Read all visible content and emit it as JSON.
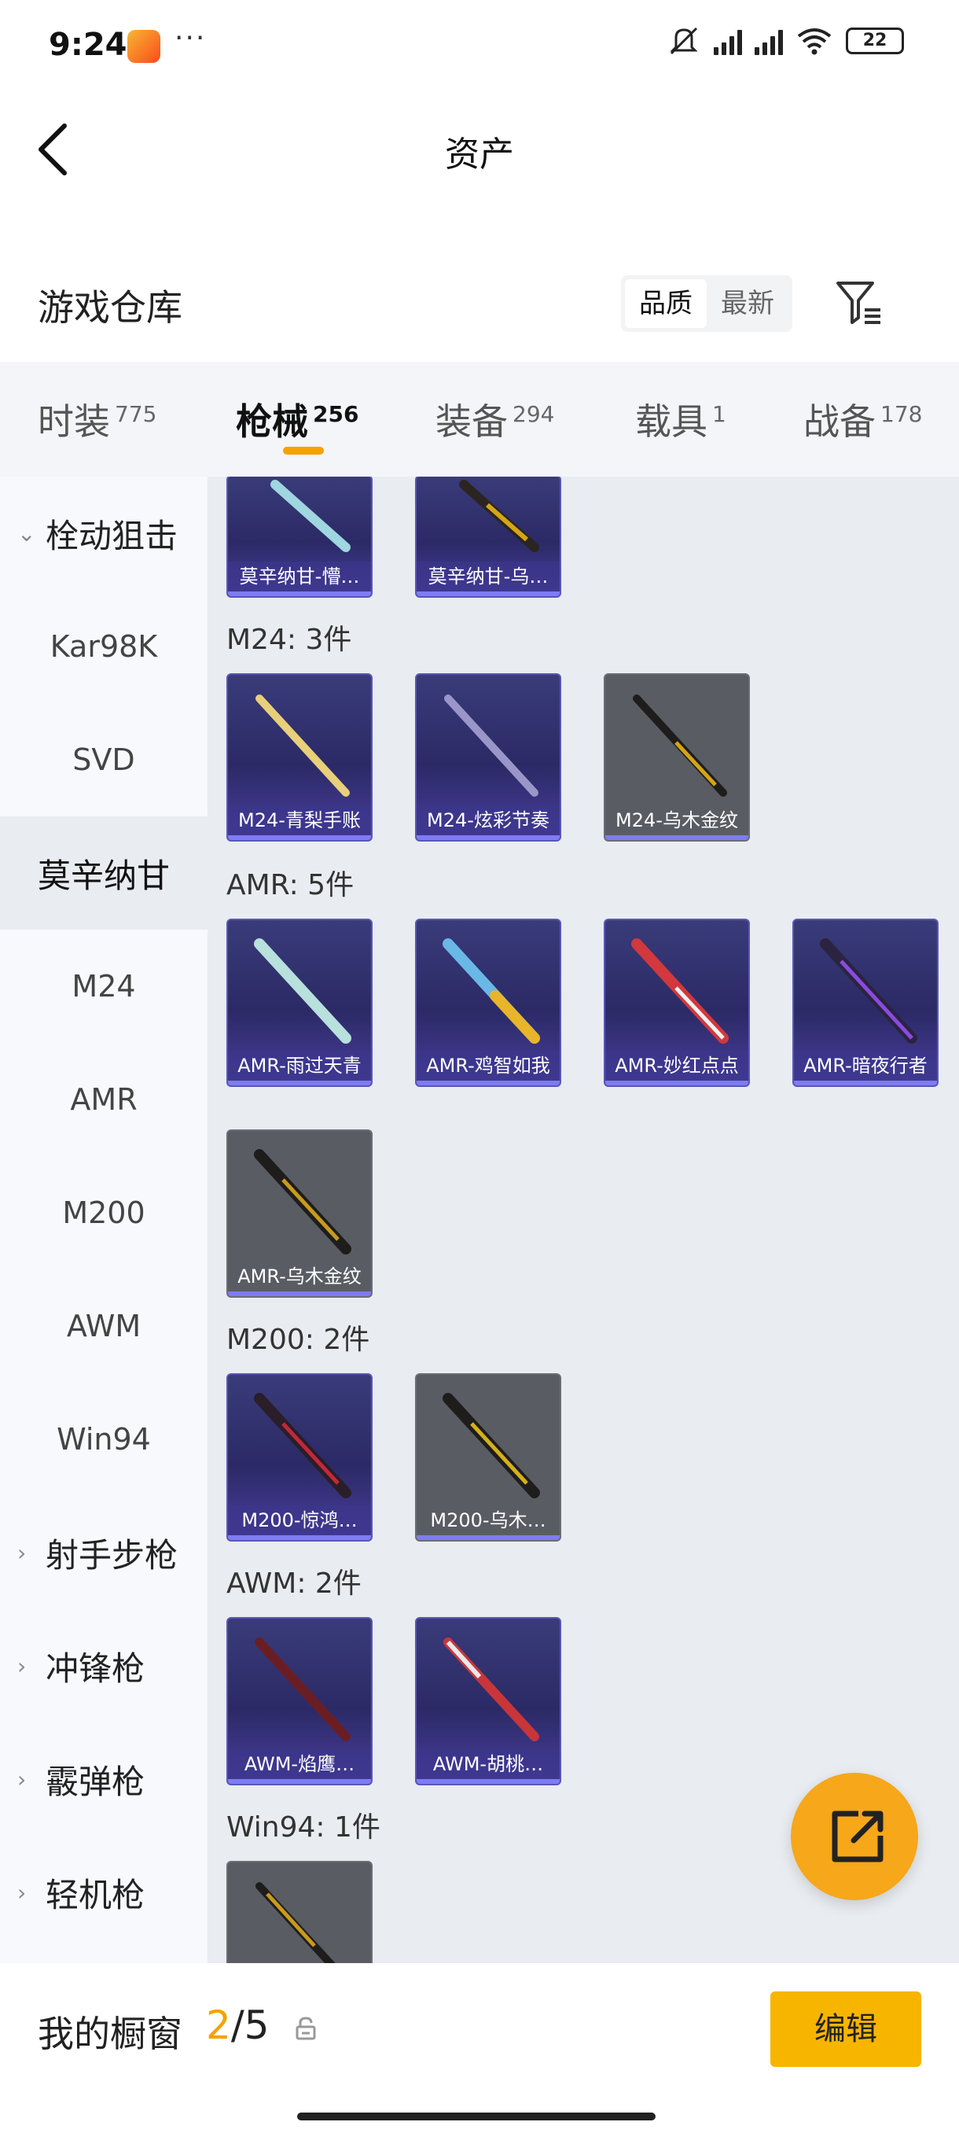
{
  "status": {
    "time": "9:24",
    "battery": "22"
  },
  "header": {
    "title": "资产"
  },
  "warehouse": {
    "title": "游戏仓库",
    "sort_quality": "品质",
    "sort_newest": "最新"
  },
  "tabs": [
    {
      "label": "时装",
      "count": "775"
    },
    {
      "label": "枪械",
      "count": "256"
    },
    {
      "label": "装备",
      "count": "294"
    },
    {
      "label": "载具",
      "count": "1"
    },
    {
      "label": "战备",
      "count": "178"
    }
  ],
  "sidebar": [
    "栓动狙击",
    "Kar98K",
    "SVD",
    "莫辛纳甘",
    "M24",
    "AMR",
    "M200",
    "AWM",
    "Win94",
    "射手步枪",
    "冲锋枪",
    "霰弹枪",
    "轻机枪"
  ],
  "groups": [
    {
      "label": "M24: 3件"
    },
    {
      "label": "AMR: 5件"
    },
    {
      "label": "M200: 2件"
    },
    {
      "label": "AWM: 2件"
    },
    {
      "label": "Win94: 1件"
    }
  ],
  "items": [
    "莫辛纳甘-懵…",
    "莫辛纳甘-乌…",
    "M24-青梨手账",
    "M24-炫彩节奏",
    "M24-乌木金纹",
    "AMR-雨过天青",
    "AMR-鸡智如我",
    "AMR-妙红点点",
    "AMR-暗夜行者",
    "AMR-乌木金纹",
    "M200-惊鸿…",
    "M200-乌木…",
    "AWM-焰鹰…",
    "AWM-胡桃…"
  ],
  "showcase": {
    "label": "我的橱窗",
    "current": "2",
    "total": "/5",
    "edit_label": "编辑"
  },
  "colors": {
    "accent": "#f5a200",
    "purple_card": "#2b2a66",
    "gray_card": "#5a5c63"
  }
}
